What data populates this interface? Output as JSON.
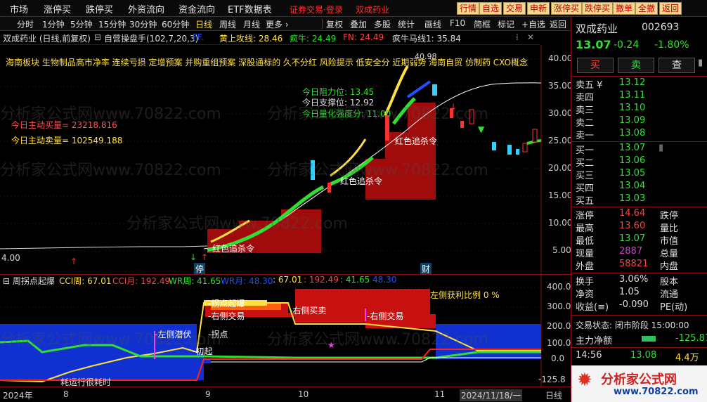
{
  "menu": {
    "items": [
      "市场",
      "涨停买",
      "跌停买",
      "外资流向",
      "资金流向",
      "ETF数据表"
    ],
    "login": "证券交易·登录",
    "stock": "双成药业",
    "quick": [
      "行情",
      "自选",
      "交易",
      "申新",
      "涨停买",
      "跌停买",
      "撤单",
      "全撤",
      "返回"
    ]
  },
  "toolbar": {
    "periods": [
      "分时",
      "1分钟",
      "5分钟",
      "15分钟",
      "30分钟",
      "60分钟",
      "日线",
      "周线",
      "月线",
      "更多 ›"
    ],
    "active": "日线",
    "tools": [
      "复权",
      "叠加",
      "多股",
      "统计",
      "画线",
      "F10",
      "简框",
      "标记",
      "+自选",
      "返回"
    ]
  },
  "info": {
    "name": "双成药业 (日线,前复权)",
    "indicator": "自营操盘手(102,7,20,3)",
    "dash": "FF.",
    "line1": "黄上攻线: 28.46",
    "line2": "疯牛: 24.49",
    "line3": "FN: 24.49",
    "line4": "疯牛马线1: 35.84"
  },
  "main": {
    "concepts": "海南板块 生物制品高市净率 连续亏损 定增预案 并购重组预案 深股通标的 久不分红 风险提示 低安全分 近期弱势 海南自贸 仿制药 CXO概念",
    "resist": "今日阻力位:  13.45",
    "support": "今日支撑位:  12.92",
    "strength": "今日量化强度分:  11.00",
    "buy": "今日主动买量= 23218.816",
    "sell": "今日主动卖量= 102549.188",
    "peak": "40.98",
    "low": "4.00",
    "kill1": "红色追杀令",
    "kill2": "红色追杀令",
    "kill3": "红色追杀令",
    "badge1": "停",
    "badge2": "财",
    "yaxis": [
      "40.00",
      "35.00",
      "30.00",
      "25.00",
      "20.00",
      "15.00",
      "10.00",
      "5.00"
    ]
  },
  "ind": {
    "name": "周拐点起爆",
    "cci": "CCI周: 67.01",
    "cci2": "CCI月: 192.49",
    "wr": "WR周: 41.65",
    "wr2": "WR月: 48.30",
    "v1": ": 67.01",
    "v2": ": 192.49",
    "v3": ": 41.65",
    "v4": "48.30",
    "profit": "左侧获利比例 0 %",
    "lbl_qibao": "拐点起爆",
    "lbl_rside": "右侧交易",
    "lbl_rbuy": "右侧买卖",
    "lbl_rside2": "右侧交易",
    "lbl_left": "左侧潜伏",
    "lbl_guai": "拐点",
    "lbl_chu": "初起",
    "lbl_time": "耗运行很耗时",
    "yaxis": [
      "400.0",
      "300.0",
      "200.0",
      "100.0",
      "0.0"
    ],
    "yneg": "-125.8"
  },
  "xaxis": [
    "2024年",
    "8",
    "9",
    "10",
    "11",
    "2024/11/18/一",
    "日线"
  ],
  "panel": {
    "title": "双成药业",
    "code": "002693",
    "price": "13.07",
    "change": "-0.24",
    "pct": "-1.80%",
    "btn_buy": "买",
    "btn_sell": "卖",
    "btn_query": "查",
    "asks": [
      [
        "卖五 ¥",
        "13.12"
      ],
      [
        "卖四",
        "13.11"
      ],
      [
        "卖三",
        "13.10"
      ],
      [
        "卖二",
        "13.09"
      ],
      [
        "卖一",
        "13.08"
      ]
    ],
    "bids": [
      [
        "买一",
        "13.07"
      ],
      [
        "买二",
        "13.06"
      ],
      [
        "买三",
        "13.05"
      ],
      [
        "买四",
        "13.04"
      ],
      [
        "买五",
        "13.03"
      ]
    ],
    "stats": [
      [
        "涨停",
        "14.64",
        "跌停",
        ""
      ],
      [
        "最高",
        "13.60",
        "量比",
        ""
      ],
      [
        "最低",
        "13.07",
        "市值",
        ""
      ],
      [
        "现量",
        "2887",
        "总量",
        ""
      ],
      [
        "外盘",
        "58821",
        "内盘",
        ""
      ]
    ],
    "stats2": [
      [
        "换手",
        "3.06%",
        "股本",
        ""
      ],
      [
        "净资",
        "1.05",
        "流通",
        ""
      ],
      [
        "收益(≡)",
        "-0.090",
        "PE(动)",
        ""
      ]
    ],
    "state": "交易状态: 闭市阶段 15:00:00",
    "flow_label": "主力净额",
    "flow_val": "-125.87",
    "tick_time": "14:56",
    "tick_price": "13.08",
    "tick_vol": "4.4万",
    "logo": "分析家公式网",
    "logo_url": "www.70822.com"
  },
  "watermark": "分析家公式网www.70822.com"
}
